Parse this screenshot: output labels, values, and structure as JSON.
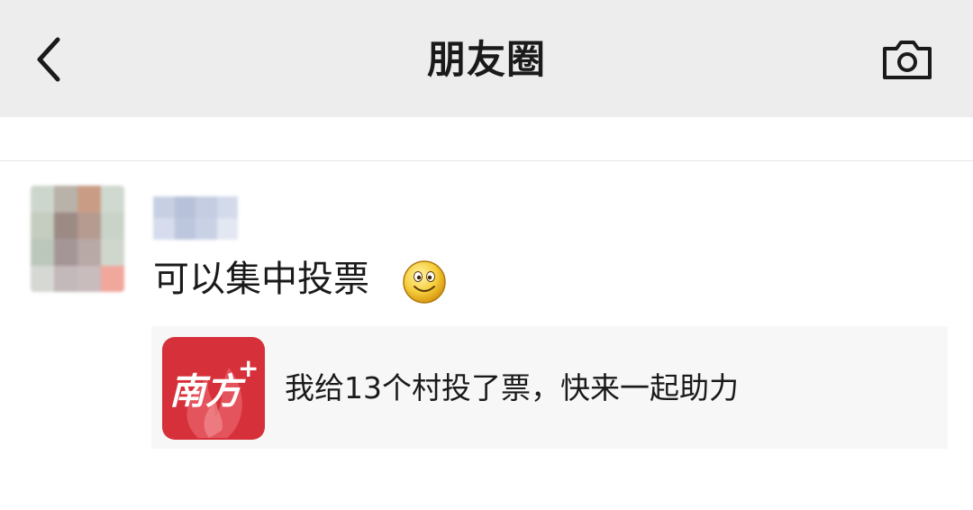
{
  "header": {
    "title": "朋友圈",
    "back_icon": "chevron-left-icon",
    "camera_icon": "camera-icon"
  },
  "post": {
    "text": "可以集中投票",
    "emoji": "smiley-face-icon",
    "share_card": {
      "app_logo_text": "南方",
      "text": "我给13个村投了票，快来一起助力"
    }
  },
  "colors": {
    "header_bg": "#ededed",
    "card_bg": "#f7f7f7",
    "app_icon_red": "#d6313a"
  }
}
